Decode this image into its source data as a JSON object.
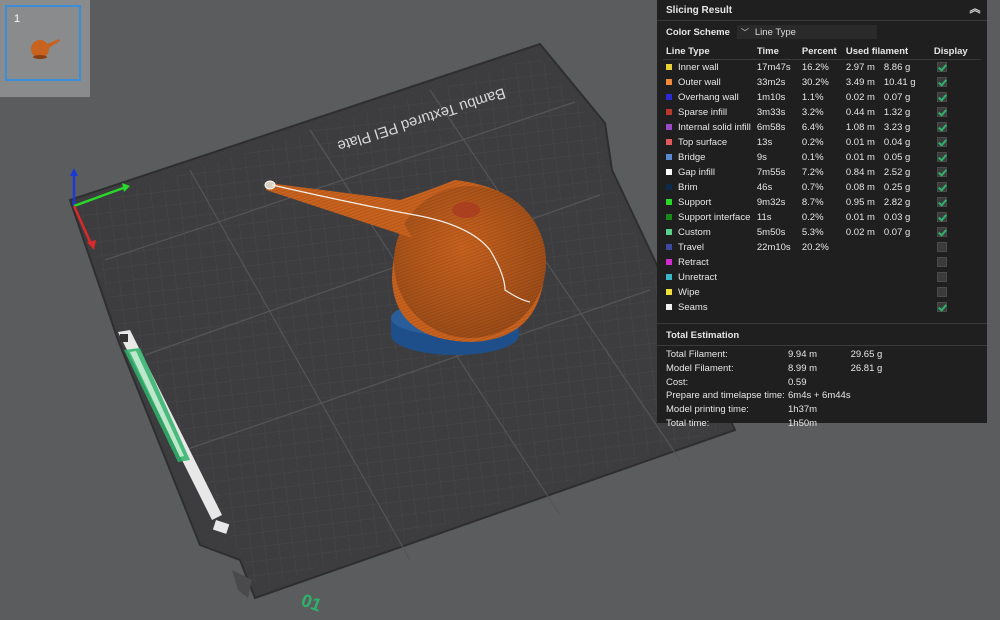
{
  "viewport": {
    "plate_label": "Bambu Textured PEI Plate",
    "plate_number": "01",
    "plate_color": "#3d3d3f",
    "model_color": "#c8621f",
    "brim_color": "#1f4f8a"
  },
  "thumbnail": {
    "index": "1"
  },
  "panel": {
    "title": "Slicing Result",
    "color_scheme_label": "Color Scheme",
    "color_scheme_value": "Line Type",
    "columns": [
      "Line Type",
      "Time",
      "Percent",
      "Used filament",
      "Display"
    ],
    "rows": [
      {
        "name": "Inner wall",
        "color": "#e8d13a",
        "time": "17m47s",
        "percent": "16.2%",
        "len": "2.97 m",
        "weight": "8.86 g",
        "display": true
      },
      {
        "name": "Outer wall",
        "color": "#f08a3a",
        "time": "33m2s",
        "percent": "30.2%",
        "len": "3.49 m",
        "weight": "10.41 g",
        "display": true
      },
      {
        "name": "Overhang wall",
        "color": "#2a2ad8",
        "time": "1m10s",
        "percent": "1.1%",
        "len": "0.02 m",
        "weight": "0.07 g",
        "display": true
      },
      {
        "name": "Sparse infill",
        "color": "#b83a2a",
        "time": "3m33s",
        "percent": "3.2%",
        "len": "0.44 m",
        "weight": "1.32 g",
        "display": true
      },
      {
        "name": "Internal solid infill",
        "color": "#9a4ac8",
        "time": "6m58s",
        "percent": "6.4%",
        "len": "1.08 m",
        "weight": "3.23 g",
        "display": true
      },
      {
        "name": "Top surface",
        "color": "#e05a5a",
        "time": "13s",
        "percent": "0.2%",
        "len": "0.01 m",
        "weight": "0.04 g",
        "display": true
      },
      {
        "name": "Bridge",
        "color": "#5a8ad0",
        "time": "9s",
        "percent": "0.1%",
        "len": "0.01 m",
        "weight": "0.05 g",
        "display": true
      },
      {
        "name": "Gap infill",
        "color": "#ffffff",
        "time": "7m55s",
        "percent": "7.2%",
        "len": "0.84 m",
        "weight": "2.52 g",
        "display": true
      },
      {
        "name": "Brim",
        "color": "#0e2a4a",
        "time": "46s",
        "percent": "0.7%",
        "len": "0.08 m",
        "weight": "0.25 g",
        "display": true
      },
      {
        "name": "Support",
        "color": "#2ad82a",
        "time": "9m32s",
        "percent": "8.7%",
        "len": "0.95 m",
        "weight": "2.82 g",
        "display": true
      },
      {
        "name": "Support interface",
        "color": "#1a8a1a",
        "time": "11s",
        "percent": "0.2%",
        "len": "0.01 m",
        "weight": "0.03 g",
        "display": true
      },
      {
        "name": "Custom",
        "color": "#5ad08a",
        "time": "5m50s",
        "percent": "5.3%",
        "len": "0.02 m",
        "weight": "0.07 g",
        "display": true
      },
      {
        "name": "Travel",
        "color": "#3a4aa0",
        "time": "22m10s",
        "percent": "20.2%",
        "len": "",
        "weight": "",
        "display": false
      },
      {
        "name": "Retract",
        "color": "#d02ad0",
        "time": "",
        "percent": "",
        "len": "",
        "weight": "",
        "display": false
      },
      {
        "name": "Unretract",
        "color": "#3ab8c8",
        "time": "",
        "percent": "",
        "len": "",
        "weight": "",
        "display": false
      },
      {
        "name": "Wipe",
        "color": "#f0e03a",
        "time": "",
        "percent": "",
        "len": "",
        "weight": "",
        "display": false
      },
      {
        "name": "Seams",
        "color": "#f0f0f0",
        "time": "",
        "percent": "",
        "len": "",
        "weight": "",
        "display": true
      }
    ],
    "total_title": "Total Estimation",
    "estimation": [
      {
        "k": "Total Filament:",
        "v1": "9.94 m",
        "v2": "29.65 g"
      },
      {
        "k": "Model Filament:",
        "v1": "8.99 m",
        "v2": "26.81 g"
      },
      {
        "k": "Cost:",
        "v1": "0.59",
        "v2": ""
      },
      {
        "k": "Prepare and timelapse time:",
        "v1": "6m4s + 6m44s",
        "v2": ""
      },
      {
        "k": "Model printing time:",
        "v1": "1h37m",
        "v2": ""
      },
      {
        "k": "Total time:",
        "v1": "1h50m",
        "v2": ""
      }
    ]
  }
}
